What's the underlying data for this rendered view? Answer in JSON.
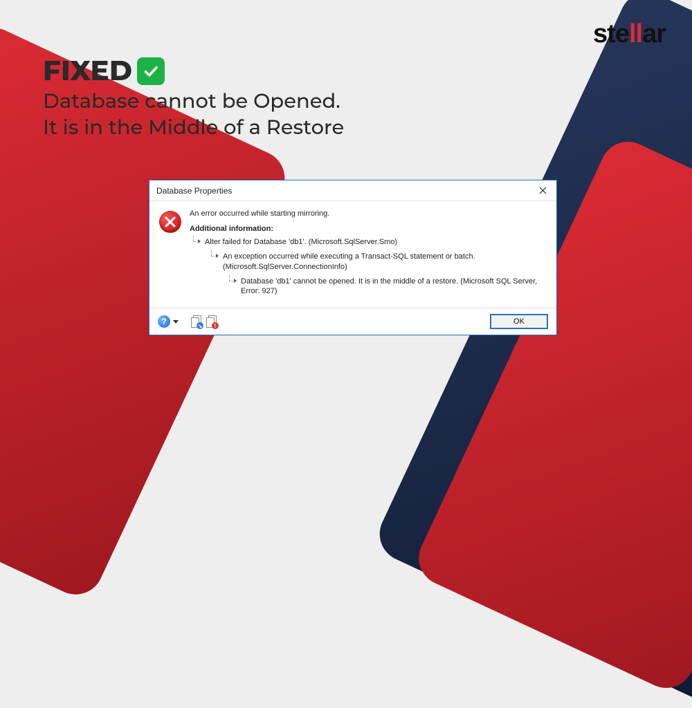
{
  "brand": {
    "logo_text_pre": "ste",
    "logo_text_mid": "ll",
    "logo_text_post": "ar"
  },
  "heading": {
    "fixed": "FIXED",
    "line1": "Database cannot be Opened.",
    "line2": "It is in the Middle of a Restore"
  },
  "dialog": {
    "title": "Database Properties",
    "main_message": "An error occurred while starting mirroring.",
    "additional_heading": "Additional information:",
    "tree": {
      "lvl1": "Alter failed for Database 'db1'.  (Microsoft.SqlServer.Smo)",
      "lvl2": "An exception occurred while executing a Transact-SQL statement or batch. (Microsoft.SqlServer.ConnectionInfo)",
      "lvl3": "Database 'db1' cannot be opened. It is in the middle of a restore. (Microsoft SQL Server, Error: 927)"
    },
    "ok_label": "OK",
    "icons": {
      "error": "error-circle-x",
      "close": "close-x",
      "help": "?",
      "copy": "copy-doc",
      "details": "details-doc"
    }
  }
}
